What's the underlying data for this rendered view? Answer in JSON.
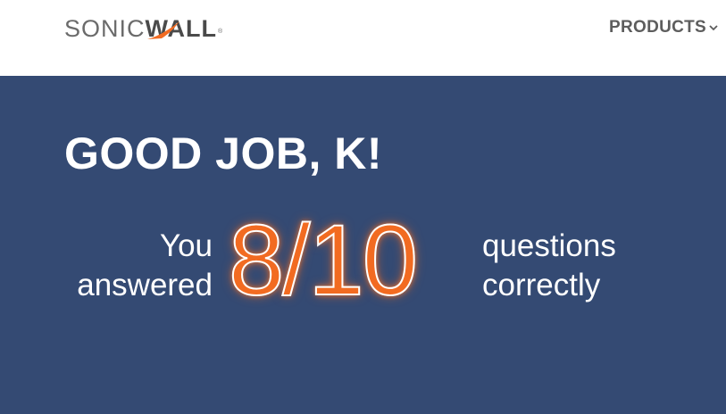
{
  "header": {
    "logo": {
      "part1": "SONIC",
      "part2": "WALL",
      "trademark": "®",
      "accent_color": "#f26b21"
    },
    "nav": {
      "products_label": "PRODUCTS",
      "products_icon": "chevron-down-icon"
    }
  },
  "hero": {
    "background_color": "#344a73",
    "greeting": "GOOD JOB, K!",
    "result": {
      "left_line1": "You",
      "left_line2": "answered",
      "score": "8/10",
      "right_line1": "questions",
      "right_line2": "correctly",
      "score_color": "#f26b21"
    }
  }
}
